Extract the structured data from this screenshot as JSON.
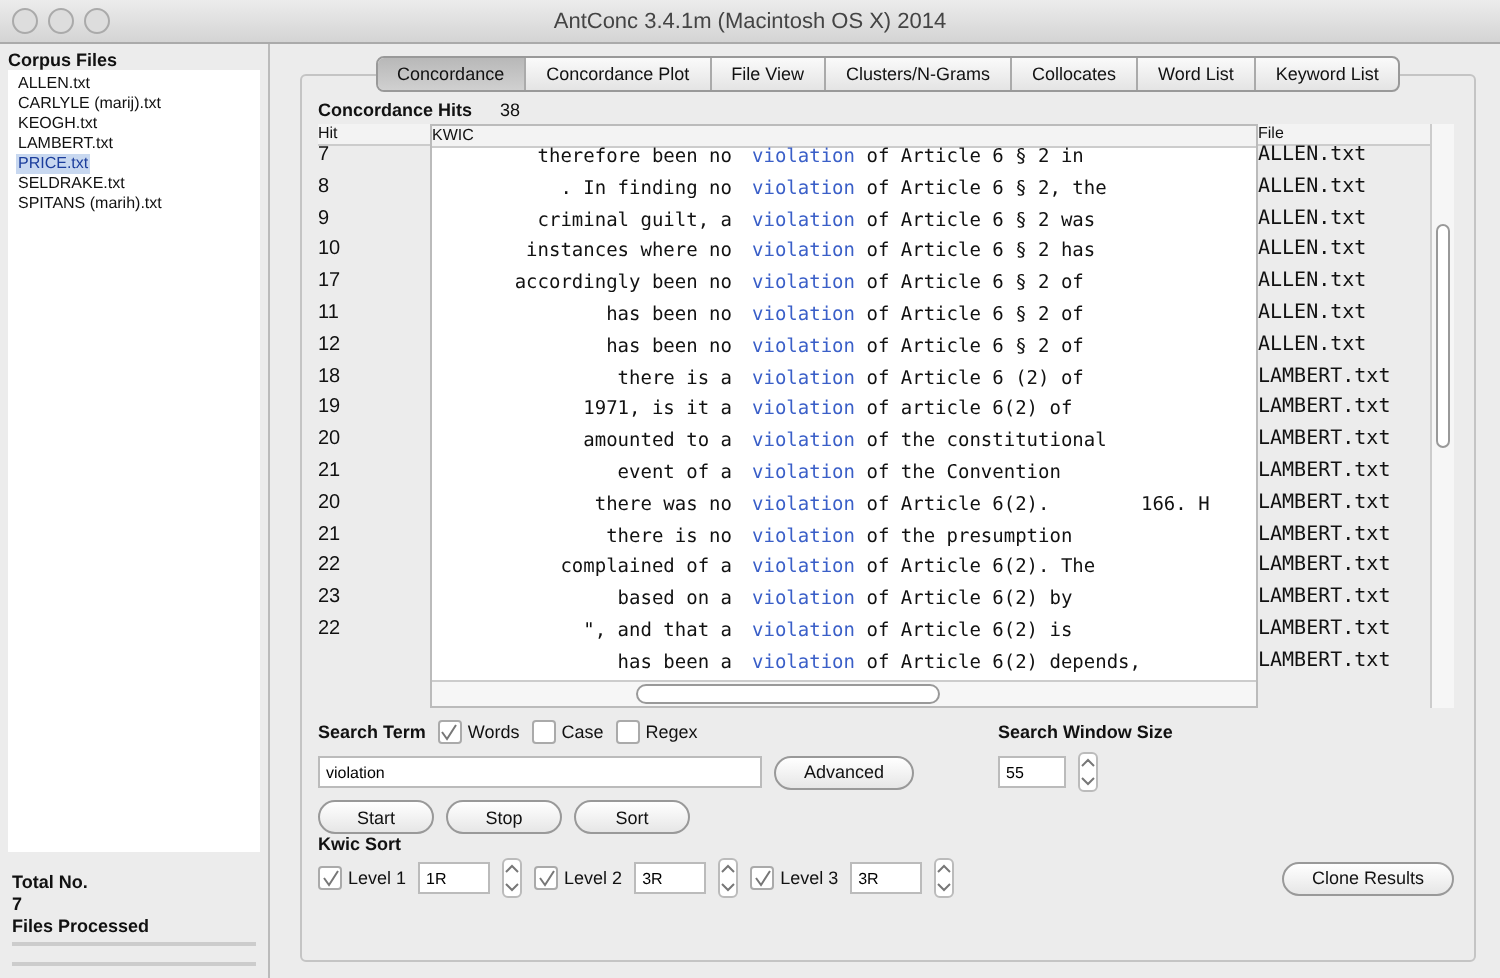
{
  "window": {
    "title": "AntConc 3.4.1m (Macintosh OS X) 2014"
  },
  "corpus": {
    "heading": "Corpus Files",
    "files": [
      {
        "name": "ALLEN.txt",
        "selected": false
      },
      {
        "name": "CARLYLE (marij).txt",
        "selected": false
      },
      {
        "name": "KEOGH.txt",
        "selected": false
      },
      {
        "name": "LAMBERT.txt",
        "selected": false
      },
      {
        "name": "PRICE.txt",
        "selected": true
      },
      {
        "name": "SELDRAKE.txt",
        "selected": false
      },
      {
        "name": "SPITANS (marih).txt",
        "selected": false
      }
    ],
    "total_label": "Total No.",
    "total": "7",
    "processed_label": "Files Processed"
  },
  "tabs": [
    {
      "label": "Concordance",
      "selected": true
    },
    {
      "label": "Concordance Plot",
      "selected": false
    },
    {
      "label": "File View",
      "selected": false
    },
    {
      "label": "Clusters/N-Grams",
      "selected": false
    },
    {
      "label": "Collocates",
      "selected": false
    },
    {
      "label": "Word List",
      "selected": false
    },
    {
      "label": "Keyword List",
      "selected": false
    }
  ],
  "hits": {
    "label": "Concordance Hits",
    "value": "38"
  },
  "table": {
    "columns": [
      "Hit",
      "KWIC",
      "File"
    ],
    "rows": [
      {
        "hit": "7",
        "left": "therefore been no",
        "key": "violation",
        "right": "of Article 6 § 2 in",
        "file": "ALLEN.txt"
      },
      {
        "hit": "8",
        "left": ". In finding no",
        "key": "violation",
        "right": "of Article 6 § 2, the",
        "file": "ALLEN.txt"
      },
      {
        "hit": "9",
        "left": "criminal guilt, a",
        "key": "violation",
        "right": "of Article 6 § 2 was",
        "file": "ALLEN.txt"
      },
      {
        "hit": "10",
        "left": "instances where no",
        "key": "violation",
        "right": "of Article 6 § 2 has",
        "file": "ALLEN.txt"
      },
      {
        "hit": "17",
        "left": "accordingly been no",
        "key": "violation",
        "right": "of Article 6 § 2 of",
        "file": "ALLEN.txt"
      },
      {
        "hit": "11",
        "left": "has been no",
        "key": "violation",
        "right": "of Article 6 § 2 of",
        "file": "ALLEN.txt"
      },
      {
        "hit": "12",
        "left": "has been no",
        "key": "violation",
        "right": "of Article 6 § 2 of",
        "file": "ALLEN.txt"
      },
      {
        "hit": "18",
        "left": "there is a",
        "key": "violation",
        "right": "of Article 6 (2) of",
        "file": "LAMBERT.txt"
      },
      {
        "hit": "19",
        "left": "1971, is it a",
        "key": "violation",
        "right": "of article 6(2) of",
        "file": "LAMBERT.txt"
      },
      {
        "hit": "20",
        "left": "amounted to a",
        "key": "violation",
        "right": "of the constitutional",
        "file": "LAMBERT.txt"
      },
      {
        "hit": "21",
        "left": "event of a",
        "key": "violation",
        "right": "of the Convention",
        "file": "LAMBERT.txt"
      },
      {
        "hit": "20",
        "left": "there was no",
        "key": "violation",
        "right": "of Article 6(2).        166. H",
        "file": "LAMBERT.txt"
      },
      {
        "hit": "21",
        "left": "there is no",
        "key": "violation",
        "right": "of the presumption",
        "file": "LAMBERT.txt"
      },
      {
        "hit": "22",
        "left": "complained of a",
        "key": "violation",
        "right": "of Article 6(2). The",
        "file": "LAMBERT.txt"
      },
      {
        "hit": "23",
        "left": "based on a",
        "key": "violation",
        "right": "of Article 6(2) by",
        "file": "LAMBERT.txt"
      },
      {
        "hit": "22",
        "left": "\", and that a",
        "key": "violation",
        "right": "of Article 6(2) is",
        "file": "LAMBERT.txt"
      },
      {
        "left": "has been a",
        "key": "violation",
        "right": "of Article 6(2) depends,",
        "file": "LAMBERT.txt"
      }
    ]
  },
  "search": {
    "label": "Search Term",
    "options": [
      {
        "label": "Words",
        "checked": true
      },
      {
        "label": "Case",
        "checked": false
      },
      {
        "label": "Regex",
        "checked": false
      }
    ],
    "value": "violation",
    "advanced": "Advanced",
    "window_label": "Search Window Size",
    "window_value": "55"
  },
  "actions": [
    "Start",
    "Stop",
    "Sort"
  ],
  "kwic_sort": {
    "label": "Kwic Sort",
    "levels": [
      {
        "label": "Level 1",
        "checked": true,
        "value": "1R"
      },
      {
        "label": "Level 2",
        "checked": true,
        "value": "3R"
      },
      {
        "label": "Level 3",
        "checked": true,
        "value": "3R"
      }
    ]
  },
  "clone": "Clone Results"
}
